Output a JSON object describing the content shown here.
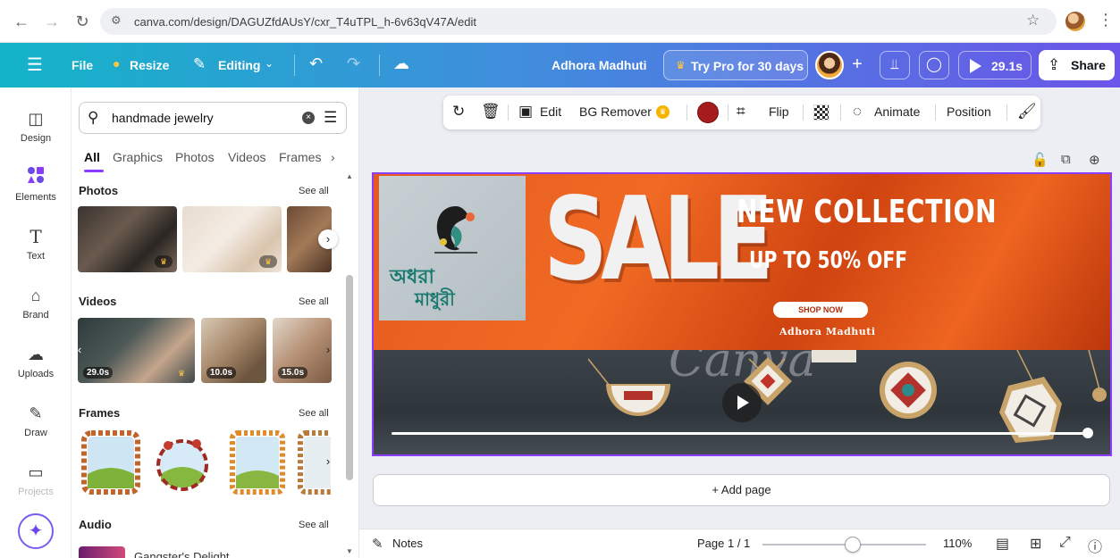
{
  "browser": {
    "url": "canva.com/design/DAGUZfdAUsY/cxr_T4uTPL_h-6v63qV47A/edit"
  },
  "header": {
    "file": "File",
    "resize": "Resize",
    "editing": "Editing",
    "design_name": "Adhora Madhuti",
    "pro_label": "Try Pro for 30 days",
    "timer": "29.1s",
    "share": "Share"
  },
  "rail": {
    "items": [
      {
        "label": "Design",
        "icon": "design-icon"
      },
      {
        "label": "Elements",
        "icon": "elements-icon"
      },
      {
        "label": "Text",
        "icon": "text-icon"
      },
      {
        "label": "Brand",
        "icon": "brand-icon"
      },
      {
        "label": "Uploads",
        "icon": "uploads-icon"
      },
      {
        "label": "Draw",
        "icon": "draw-icon"
      },
      {
        "label": "Projects",
        "icon": "projects-icon"
      }
    ]
  },
  "panel": {
    "search_value": "handmade jewelry",
    "tabs": [
      "All",
      "Graphics",
      "Photos",
      "Videos",
      "Frames"
    ],
    "see_all": "See all",
    "sections": {
      "photos": "Photos",
      "videos": "Videos",
      "frames": "Frames",
      "audio": "Audio"
    },
    "video_durations": [
      "29.0s",
      "10.0s",
      "15.0s"
    ],
    "audio_track": "Gangster's Delight"
  },
  "toolbar": {
    "edit": "Edit",
    "bg_remover": "BG Remover",
    "flip": "Flip",
    "animate": "Animate",
    "position": "Position",
    "color": "#a61c1c"
  },
  "design": {
    "logo_line1": "অধরা",
    "logo_line2": "মাধুরী",
    "sale": "SALE",
    "headline": "NEW  COLLECTION",
    "discount": "UP TO 50% OFF",
    "cta": "SHOP NOW",
    "brand": "Adhora Madhuti",
    "watermark": "Canva"
  },
  "canvas": {
    "add_page": "+ Add page"
  },
  "footer": {
    "notes": "Notes",
    "page_indicator": "Page 1 / 1",
    "zoom": "110%",
    "zoom_fraction": 0.55
  }
}
